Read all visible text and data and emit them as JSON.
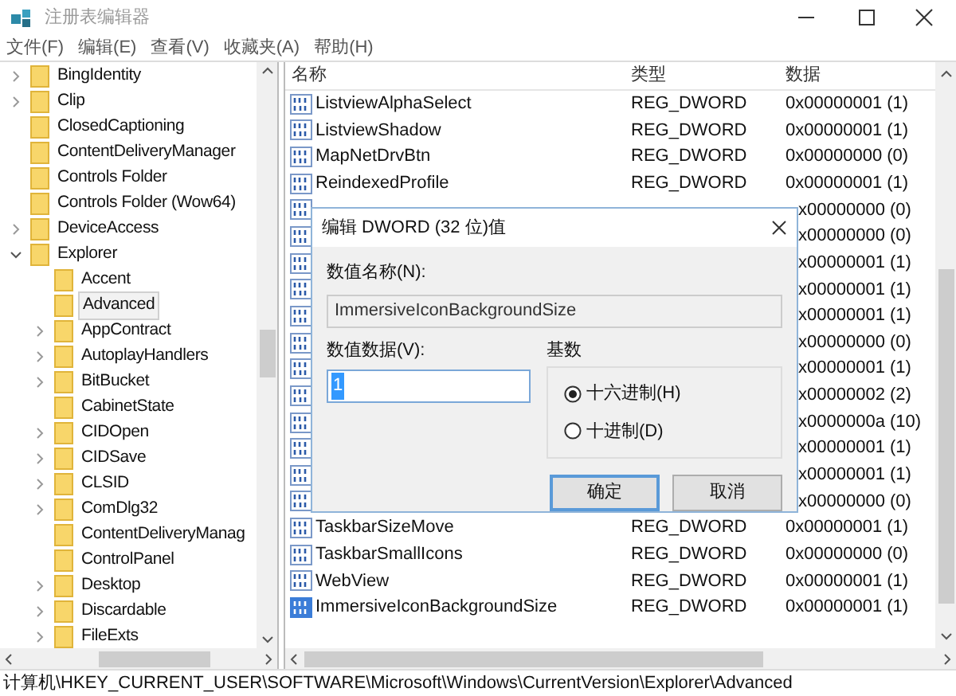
{
  "window": {
    "title": "注册表编辑器"
  },
  "menu": [
    "文件(F)",
    "编辑(E)",
    "查看(V)",
    "收藏夹(A)",
    "帮助(H)"
  ],
  "tree": [
    {
      "label": "BingIdentity",
      "expanded": false,
      "selected": false
    },
    {
      "label": "Clip",
      "expanded": false,
      "selected": false
    },
    {
      "label": "ClosedCaptioning",
      "selected": false
    },
    {
      "label": "ContentDeliveryManager",
      "selected": false
    },
    {
      "label": "Controls Folder",
      "selected": false
    },
    {
      "label": "Controls Folder (Wow64)",
      "selected": false
    },
    {
      "label": "DeviceAccess",
      "expanded": false,
      "selected": false
    },
    {
      "label": "Explorer",
      "expanded": true,
      "selected": false,
      "children": [
        {
          "label": "Accent",
          "selected": false
        },
        {
          "label": "Advanced",
          "selected": true
        },
        {
          "label": "AppContract",
          "expanded": false,
          "selected": false
        },
        {
          "label": "AutoplayHandlers",
          "expanded": false,
          "selected": false
        },
        {
          "label": "BitBucket",
          "expanded": false,
          "selected": false
        },
        {
          "label": "CabinetState",
          "selected": false
        },
        {
          "label": "CIDOpen",
          "expanded": false,
          "selected": false
        },
        {
          "label": "CIDSave",
          "expanded": false,
          "selected": false
        },
        {
          "label": "CLSID",
          "expanded": false,
          "selected": false
        },
        {
          "label": "ComDlg32",
          "expanded": false,
          "selected": false
        },
        {
          "label": "ContentDeliveryManag",
          "selected": false
        },
        {
          "label": "ControlPanel",
          "selected": false
        },
        {
          "label": "Desktop",
          "expanded": false,
          "selected": false
        },
        {
          "label": "Discardable",
          "expanded": false,
          "selected": false
        },
        {
          "label": "FileExts",
          "expanded": false,
          "selected": false
        }
      ]
    }
  ],
  "table": {
    "columns": [
      "名称",
      "类型",
      "数据"
    ],
    "rows": [
      {
        "name": "ListviewAlphaSelect",
        "type": "REG_DWORD",
        "data": "0x00000001 (1)",
        "selected": false
      },
      {
        "name": "ListviewShadow",
        "type": "REG_DWORD",
        "data": "0x00000001 (1)",
        "selected": false
      },
      {
        "name": "MapNetDrvBtn",
        "type": "REG_DWORD",
        "data": "0x00000000 (0)",
        "selected": false
      },
      {
        "name": "ReindexedProfile",
        "type": "REG_DWORD",
        "data": "0x00000001 (1)",
        "selected": false
      },
      {
        "data": "x00000000 (0)",
        "selected": false
      },
      {
        "data": "x00000000 (0)",
        "selected": false
      },
      {
        "data": "x00000001 (1)",
        "selected": false
      },
      {
        "data": "x00000001 (1)",
        "selected": false
      },
      {
        "data": "x00000001 (1)",
        "selected": false
      },
      {
        "data": "x00000000 (0)",
        "selected": false
      },
      {
        "data": "x00000001 (1)",
        "selected": false
      },
      {
        "data": "x00000002 (2)",
        "selected": false
      },
      {
        "data": "x0000000a (10)",
        "selected": false
      },
      {
        "data": "x00000001 (1)",
        "selected": false
      },
      {
        "data": "x00000001 (1)",
        "selected": false
      },
      {
        "data": "x00000000 (0)",
        "selected": false
      },
      {
        "name": "TaskbarSizeMove",
        "type": "REG_DWORD",
        "data": "0x00000001 (1)",
        "selected": false
      },
      {
        "name": "TaskbarSmallIcons",
        "type": "REG_DWORD",
        "data": "0x00000000 (0)",
        "selected": false
      },
      {
        "name": "WebView",
        "type": "REG_DWORD",
        "data": "0x00000001 (1)",
        "selected": false
      },
      {
        "name": "ImmersiveIconBackgroundSize",
        "type": "REG_DWORD",
        "data": "0x00000001 (1)",
        "selected": true
      }
    ]
  },
  "status_bar": "计算机\\HKEY_CURRENT_USER\\SOFTWARE\\Microsoft\\Windows\\CurrentVersion\\Explorer\\Advanced",
  "dialog": {
    "title": "编辑 DWORD (32 位)值",
    "name_label": "数值名称(N):",
    "name_value": "ImmersiveIconBackgroundSize",
    "data_label": "数值数据(V):",
    "data_value": "1",
    "base_label": "基数",
    "radios": [
      {
        "label": "十六进制(H)",
        "selected": true
      },
      {
        "label": "十进制(D)",
        "selected": false
      }
    ],
    "buttons": [
      {
        "label": "确定",
        "kind": "default"
      },
      {
        "label": "取消",
        "kind": "normal"
      }
    ]
  }
}
